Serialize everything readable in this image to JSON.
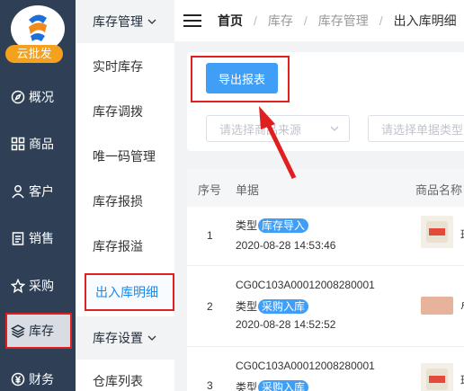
{
  "brand": {
    "label": "云批发"
  },
  "rail": {
    "items": [
      {
        "icon": "compass-icon",
        "label": "概况"
      },
      {
        "icon": "grid-icon",
        "label": "商品"
      },
      {
        "icon": "person-icon",
        "label": "客户"
      },
      {
        "icon": "clipboard-icon",
        "label": "销售"
      },
      {
        "icon": "cart-icon",
        "label": "采购"
      },
      {
        "icon": "layers-icon",
        "label": "库存"
      },
      {
        "icon": "yen-icon",
        "label": "财务"
      }
    ]
  },
  "submenu": {
    "group1": "库存管理",
    "items": [
      "实时库存",
      "库存调拨",
      "唯一码管理",
      "库存报损",
      "库存报溢",
      "出入库明细"
    ],
    "group2": "库存设置",
    "items2": [
      "仓库列表"
    ]
  },
  "breadcrumb": {
    "home": "首页",
    "level1": "库存",
    "level2": "库存管理",
    "current": "出入库明细"
  },
  "filters": {
    "export_label": "导出报表",
    "source_placeholder": "请选择商品来源",
    "type_placeholder": "请选择单据类型"
  },
  "table": {
    "headers": {
      "index": "序号",
      "doc": "单据",
      "product": "商品名称"
    },
    "rows": [
      {
        "index": "1",
        "code": "",
        "type_label": "类型",
        "tag": "库存导入",
        "time": "2020-08-28 14:53:46",
        "product": "班"
      },
      {
        "index": "2",
        "code": "CG0C103A00012008280001",
        "type_label": "类型",
        "tag": "采购入库",
        "time": "2020-08-28 14:52:52",
        "product": "卢"
      },
      {
        "index": "3",
        "code": "CG0C103A00012008280001",
        "type_label": "类型",
        "tag": "采购入库",
        "time": "",
        "product": "班"
      }
    ]
  },
  "colors": {
    "rail": "#2f4056",
    "accent": "#3f9ef5",
    "annotation": "#e02020",
    "brand": "#f4a11d"
  }
}
